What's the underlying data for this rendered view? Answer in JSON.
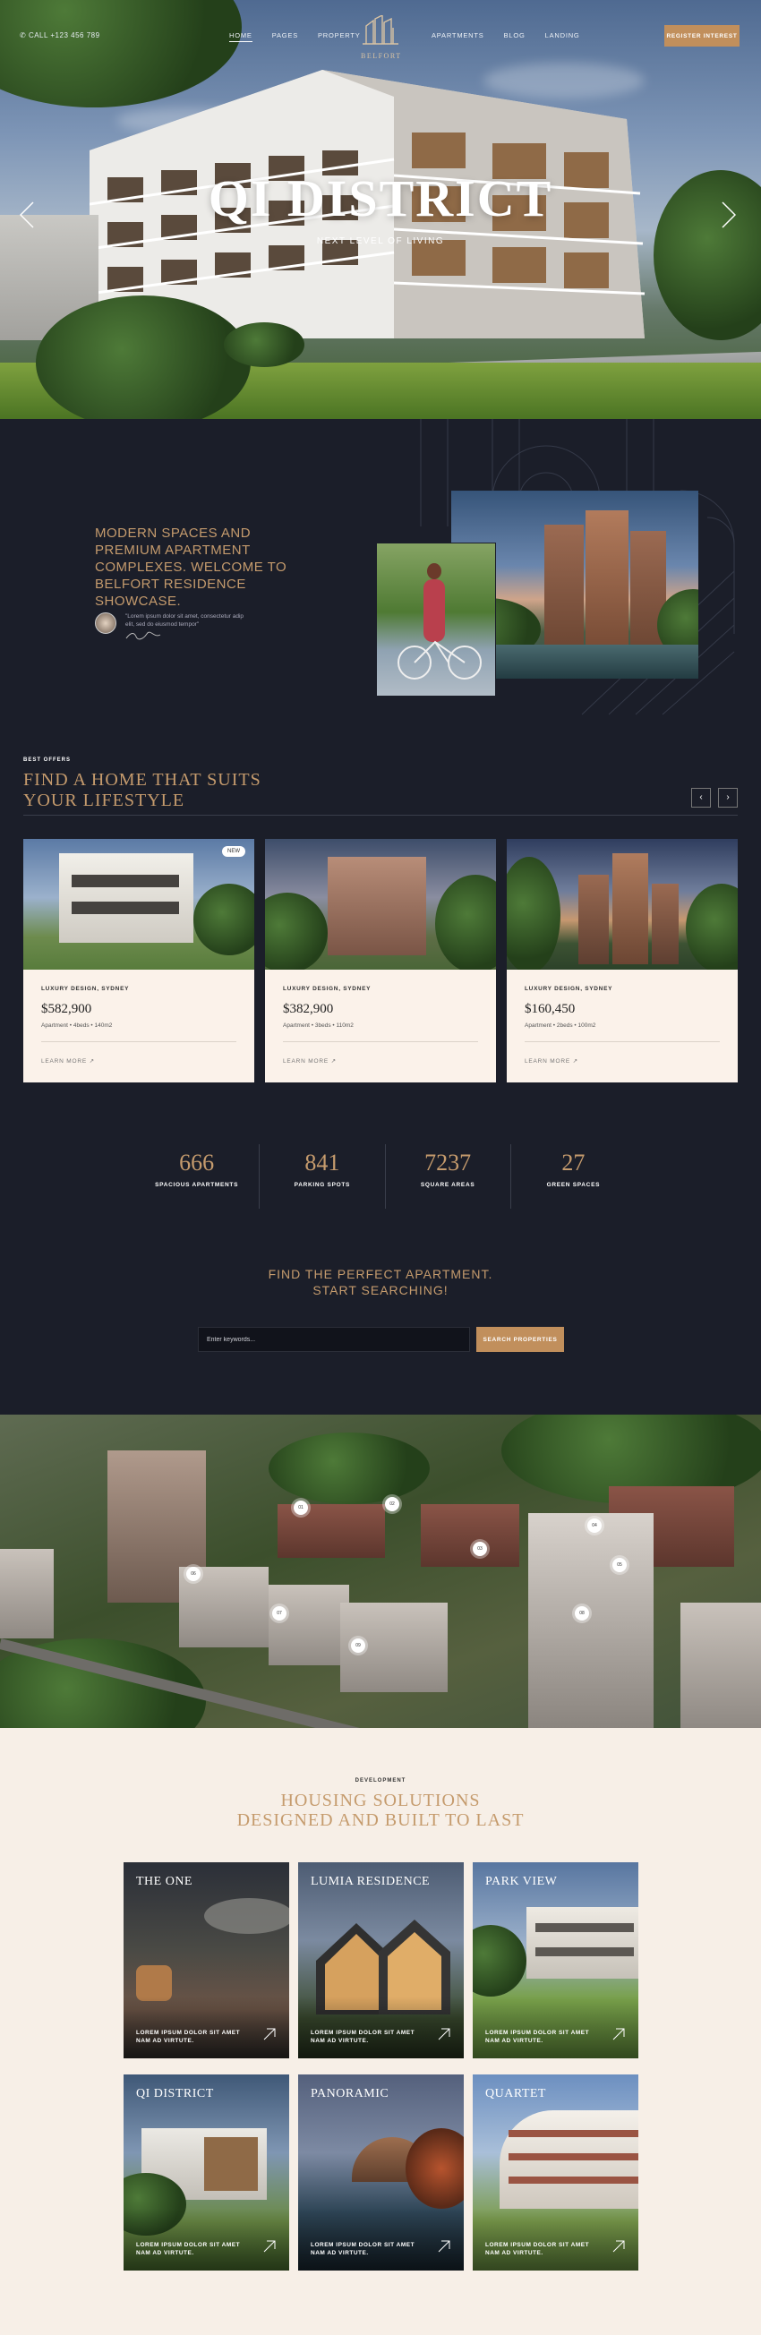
{
  "nav": {
    "phone": "CALL +123 456 789",
    "left_links": [
      "HOME",
      "PAGES",
      "PROPERTY"
    ],
    "right_links": [
      "APARTMENTS",
      "BLOG",
      "LANDING"
    ],
    "logo_text": "BELFORT",
    "register_label": "REGISTER INTEREST"
  },
  "hero": {
    "title": "QI DISTRICT",
    "subtitle": "NEXT LEVEL OF LIVING"
  },
  "intro": {
    "headline": "MODERN SPACES AND PREMIUM APARTMENT COMPLEXES. WELCOME TO BELFORT RESIDENCE SHOWCASE.",
    "quote": "\"Lorem ipsum dolor sit amet, consectetur adip elit, sed do eiusmod tempor\""
  },
  "offers": {
    "label": "BEST OFFERS",
    "title_line1": "FIND A HOME THAT SUITS",
    "title_line2": "YOUR LIFESTYLE",
    "cards": [
      {
        "badge": "NEW",
        "location": "LUXURY DESIGN, SYDNEY",
        "price": "$582,900",
        "spec": "Apartment • 4beds • 140m2",
        "more": "LEARN MORE"
      },
      {
        "badge": "",
        "location": "LUXURY DESIGN, SYDNEY",
        "price": "$382,900",
        "spec": "Apartment • 3beds • 110m2",
        "more": "LEARN MORE"
      },
      {
        "badge": "",
        "location": "LUXURY DESIGN, SYDNEY",
        "price": "$160,450",
        "spec": "Apartment • 2beds • 100m2",
        "more": "LEARN MORE"
      }
    ]
  },
  "stats": [
    {
      "number": "666",
      "label": "SPACIOUS APARTMENTS"
    },
    {
      "number": "841",
      "label": "PARKING SPOTS"
    },
    {
      "number": "7237",
      "label": "SQUARE AREAS"
    },
    {
      "number": "27",
      "label": "GREEN SPACES"
    }
  ],
  "search": {
    "line1": "FIND THE PERFECT APARTMENT.",
    "line2": "START SEARCHING!",
    "placeholder": "Enter keywords...",
    "button": "SEARCH PROPERTIES"
  },
  "development": {
    "label": "DEVELOPMENT",
    "title_line1": "HOUSING SOLUTIONS",
    "title_line2": "DESIGNED AND BUILT TO LAST",
    "tiles": [
      {
        "title": "THE ONE",
        "desc": "LOREM IPSUM DOLOR SIT AMET NAM AD VIRTUTE."
      },
      {
        "title": "LUMIA RESIDENCE",
        "desc": "LOREM IPSUM DOLOR SIT AMET NAM AD VIRTUTE."
      },
      {
        "title": "PARK VIEW",
        "desc": "LOREM IPSUM DOLOR SIT AMET NAM AD VIRTUTE."
      },
      {
        "title": "QI DISTRICT",
        "desc": "LOREM IPSUM DOLOR SIT AMET NAM AD VIRTUTE."
      },
      {
        "title": "PANORAMIC",
        "desc": "LOREM IPSUM DOLOR SIT AMET NAM AD VIRTUTE."
      },
      {
        "title": "QUARTET",
        "desc": "LOREM IPSUM DOLOR SIT AMET NAM AD VIRTUTE."
      }
    ]
  },
  "colors": {
    "accent": "#c59b6d",
    "button": "#c18f5c",
    "dark_bg": "#1b1e29",
    "light_bg": "#f7efe7"
  }
}
